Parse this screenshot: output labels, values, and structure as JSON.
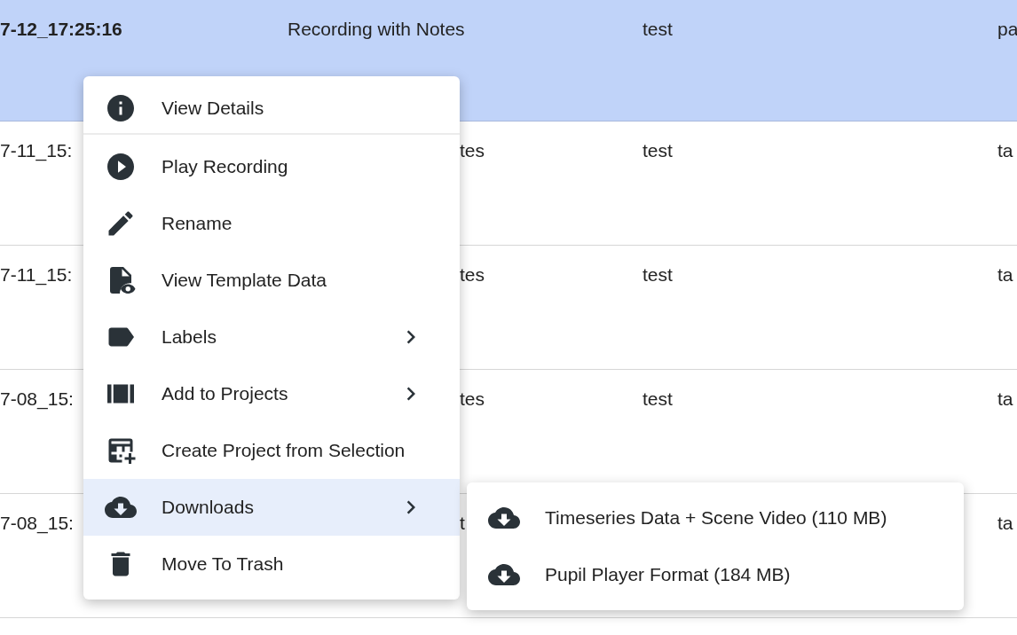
{
  "table": {
    "rows": [
      {
        "selected": true,
        "column_1": "7-12_17:25:16",
        "column_2": "Recording with Notes",
        "column_3": "test",
        "column_4": "pa"
      },
      {
        "selected": false,
        "column_1": "7-11_15:",
        "column_2": "tes",
        "column_3": "test",
        "column_4": "ta"
      },
      {
        "selected": false,
        "column_1": "7-11_15:",
        "column_2": "tes",
        "column_3": "test",
        "column_4": "ta"
      },
      {
        "selected": false,
        "column_1": "7-08_15:",
        "column_2": "tes",
        "column_3": "test",
        "column_4": "ta"
      },
      {
        "selected": false,
        "column_1": "7-08_15:",
        "column_2": "t",
        "column_4": "ta"
      }
    ]
  },
  "context_menu": {
    "items": [
      {
        "label": "View Details",
        "has_submenu": false,
        "selected": false,
        "divider_after": true
      },
      {
        "label": "Play Recording",
        "has_submenu": false,
        "selected": false,
        "divider_after": false
      },
      {
        "label": "Rename",
        "has_submenu": false,
        "selected": false,
        "divider_after": false
      },
      {
        "label": "View Template Data",
        "has_submenu": false,
        "selected": false,
        "divider_after": false
      },
      {
        "label": "Labels",
        "has_submenu": true,
        "selected": false,
        "divider_after": false
      },
      {
        "label": "Add to Projects",
        "has_submenu": true,
        "selected": false,
        "divider_after": false
      },
      {
        "label": "Create Project from Selection",
        "has_submenu": false,
        "selected": false,
        "divider_after": false
      },
      {
        "label": "Downloads",
        "has_submenu": true,
        "selected": true,
        "divider_after": false
      },
      {
        "label": "Move To Trash",
        "has_submenu": false,
        "selected": false,
        "divider_after": false
      }
    ]
  },
  "submenu": {
    "items": [
      {
        "label": "Timeseries Data + Scene Video (110 MB)"
      },
      {
        "label": "Pupil Player Format (184 MB)"
      }
    ]
  }
}
